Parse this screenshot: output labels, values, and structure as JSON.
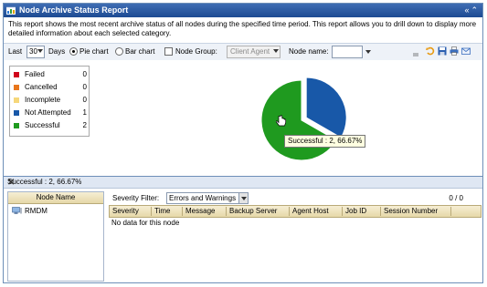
{
  "window": {
    "title": "Node Archive Status Report",
    "title_buttons": "«⌃"
  },
  "description": "This report shows the most recent archive status of all nodes during the specified time period. This report allows you to drill down to display more detailed information about each selected category.",
  "toolbar": {
    "last_label": "Last",
    "days_value": "30",
    "days_label": "Days",
    "pie_label": "Pie chart",
    "bar_label": "Bar chart",
    "node_group_label": "Node Group:",
    "node_group_value": "Client Agent",
    "node_name_label": "Node name:",
    "node_name_value": ""
  },
  "chart_data": {
    "type": "pie",
    "categories": [
      "Failed",
      "Cancelled",
      "Incomplete",
      "Not Attempted",
      "Successful"
    ],
    "values": [
      0,
      0,
      0,
      1,
      2
    ],
    "colors": [
      "#d0021b",
      "#e8761c",
      "#f6d77a",
      "#1858a8",
      "#1f9a1f"
    ],
    "legend_placement": "left"
  },
  "tooltip": "Successful : 2, 66.67%",
  "lower": {
    "header": "Successful : 2, 66.67%",
    "nodes_header": "Node Name",
    "nodes": [
      "RMDM"
    ],
    "severity_label": "Severity Filter:",
    "severity_value": "Errors and Warnings",
    "count": "0 / 0",
    "columns": [
      "Severity",
      "Time",
      "Message",
      "Backup Server",
      "Agent Host",
      "Job ID",
      "Session Number"
    ],
    "empty_text": "No data for this node"
  }
}
